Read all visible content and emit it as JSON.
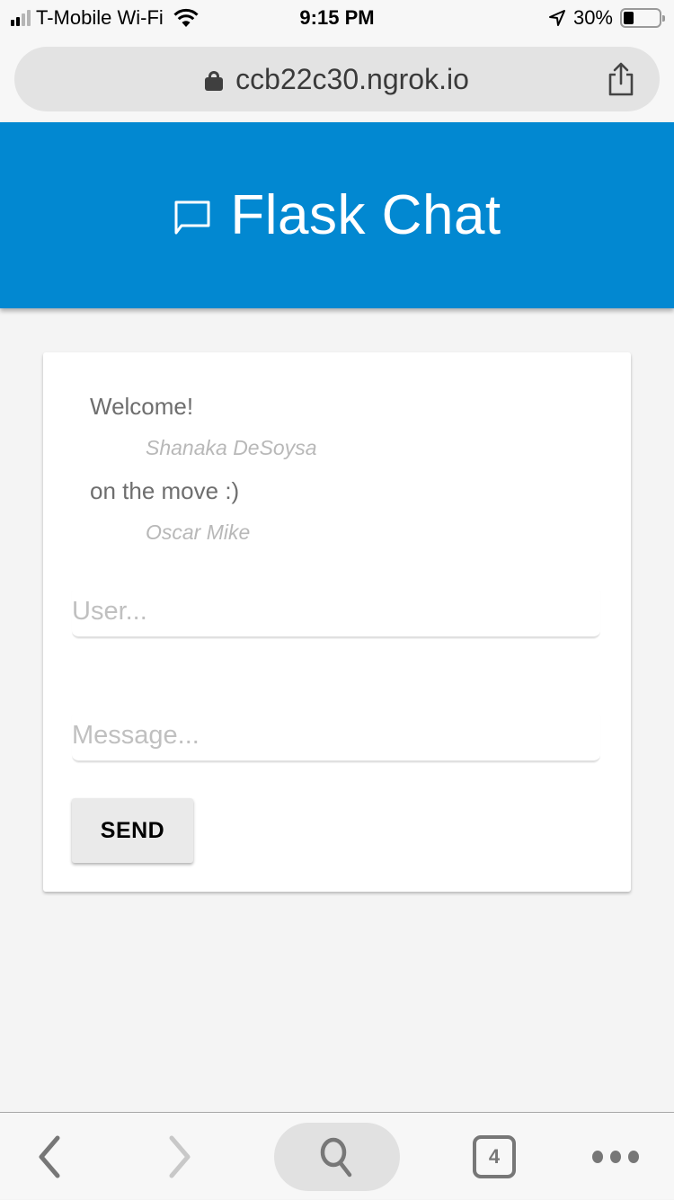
{
  "status_bar": {
    "carrier": "T-Mobile Wi-Fi",
    "time": "9:15 PM",
    "battery_percent_label": "30%",
    "battery_level": 0.3,
    "signal_bars_active": 2,
    "signal_bars_total": 4
  },
  "browser": {
    "url": "ccb22c30.ngrok.io",
    "tab_count": "4"
  },
  "app": {
    "title": "Flask Chat",
    "header_color": "#0288d1"
  },
  "chat": {
    "messages": [
      {
        "text": "Welcome!",
        "user": "Shanaka DeSoysa"
      },
      {
        "text": "on the move :)",
        "user": "Oscar Mike"
      }
    ]
  },
  "form": {
    "user_placeholder": "User...",
    "user_value": "",
    "message_placeholder": "Message...",
    "message_value": "",
    "send_label": "SEND"
  }
}
